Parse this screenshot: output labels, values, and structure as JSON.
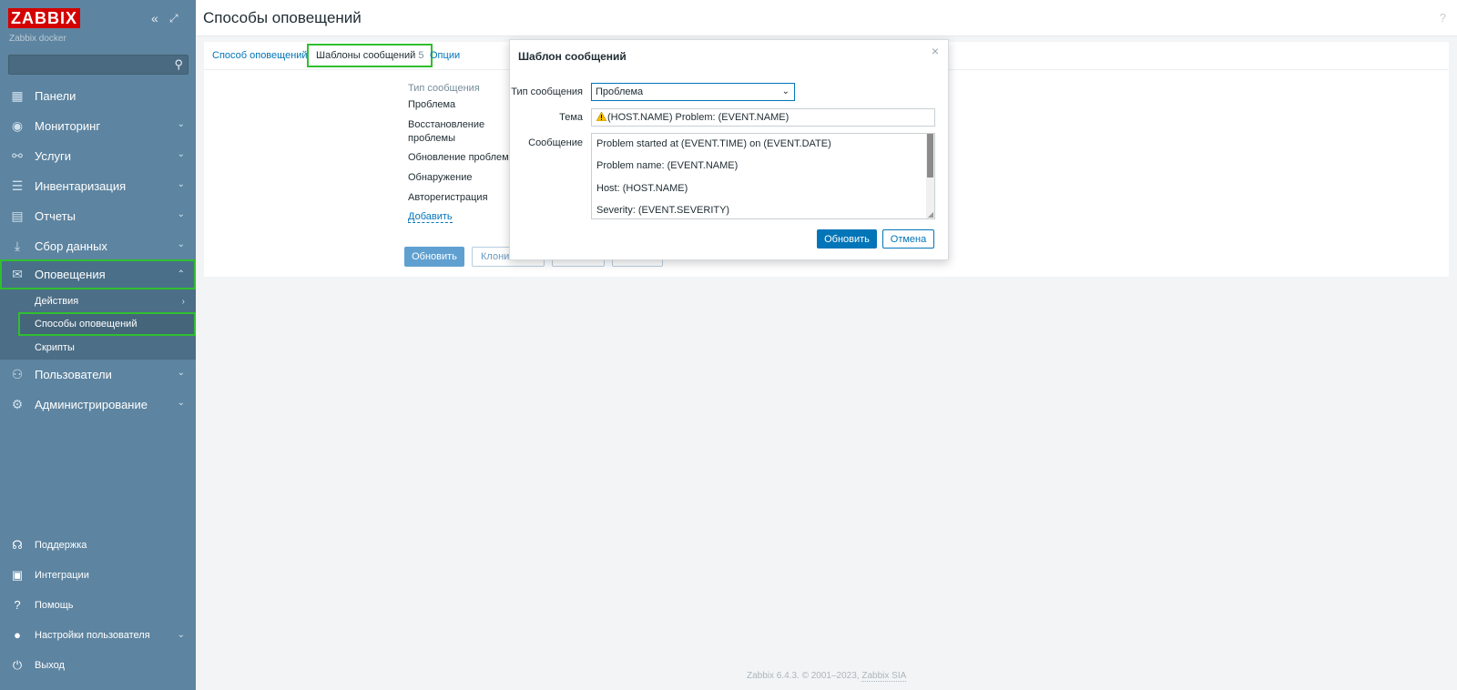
{
  "sidebar": {
    "logo": "ZABBIX",
    "server_name": "Zabbix docker",
    "collapse_icon": "double-chevron-left",
    "kiosk_icon": "expand-corner",
    "search_placeholder": "",
    "menu": [
      {
        "label": "Панели",
        "icon": "dashboard-icon"
      },
      {
        "label": "Мониторинг",
        "icon": "eye-icon"
      },
      {
        "label": "Услуги",
        "icon": "hierarchy-icon"
      },
      {
        "label": "Инвентаризация",
        "icon": "list-icon"
      },
      {
        "label": "Отчеты",
        "icon": "report-icon"
      },
      {
        "label": "Сбор данных",
        "icon": "download-icon"
      },
      {
        "label": "Оповещения",
        "icon": "envelope-icon"
      },
      {
        "label": "Пользователи",
        "icon": "users-icon"
      },
      {
        "label": "Администрирование",
        "icon": "gear-icon"
      }
    ],
    "submenu": [
      {
        "label": "Действия"
      },
      {
        "label": "Способы оповещений"
      },
      {
        "label": "Скрипты"
      }
    ],
    "bottom": [
      {
        "label": "Поддержка",
        "icon": "headset-icon"
      },
      {
        "label": "Интеграции",
        "icon": "integrations-icon"
      },
      {
        "label": "Помощь",
        "icon": "question-icon"
      },
      {
        "label": "Настройки пользователя",
        "icon": "user-icon"
      },
      {
        "label": "Выход",
        "icon": "power-icon"
      }
    ]
  },
  "header": {
    "title": "Способы оповещений",
    "help": "?"
  },
  "tabs": [
    {
      "label": "Способ оповещений"
    },
    {
      "label": "Шаблоны сообщений",
      "count": "5"
    },
    {
      "label": "Опции"
    }
  ],
  "templates": {
    "header": "Тип сообщения",
    "rows": [
      "Проблема",
      "Восстановление проблемы",
      "Обновление проблемы",
      "Обнаружение",
      "Авторегистрация"
    ],
    "rows_display": [
      "Проблема",
      "Восстановление",
      "проблемы",
      "Обновление проблемы",
      "Обнаружение",
      "Авторегистрация"
    ],
    "add_link": "Добавить"
  },
  "panel_buttons": {
    "update": "Обновить",
    "clone": "Клони"
  },
  "modal": {
    "title": "Шаблон сообщений",
    "type_label": "Тип сообщения",
    "type_value": "Проблема",
    "subject_label": "Тема",
    "subject_value": "(HOST.NAME) Problem: (EVENT.NAME)",
    "message_label": "Сообщение",
    "message_lines": [
      "Problem started at (EVENT.TIME) on (EVENT.DATE)",
      "Problem name: (EVENT.NAME)",
      "Host: (HOST.NAME)",
      "Severity: (EVENT.SEVERITY)"
    ],
    "update_button": "Обновить",
    "cancel_button": "Отмена",
    "close": "×"
  },
  "footer": {
    "text": "Zabbix 6.4.3. © 2001–2023, ",
    "link": "Zabbix SIA"
  }
}
